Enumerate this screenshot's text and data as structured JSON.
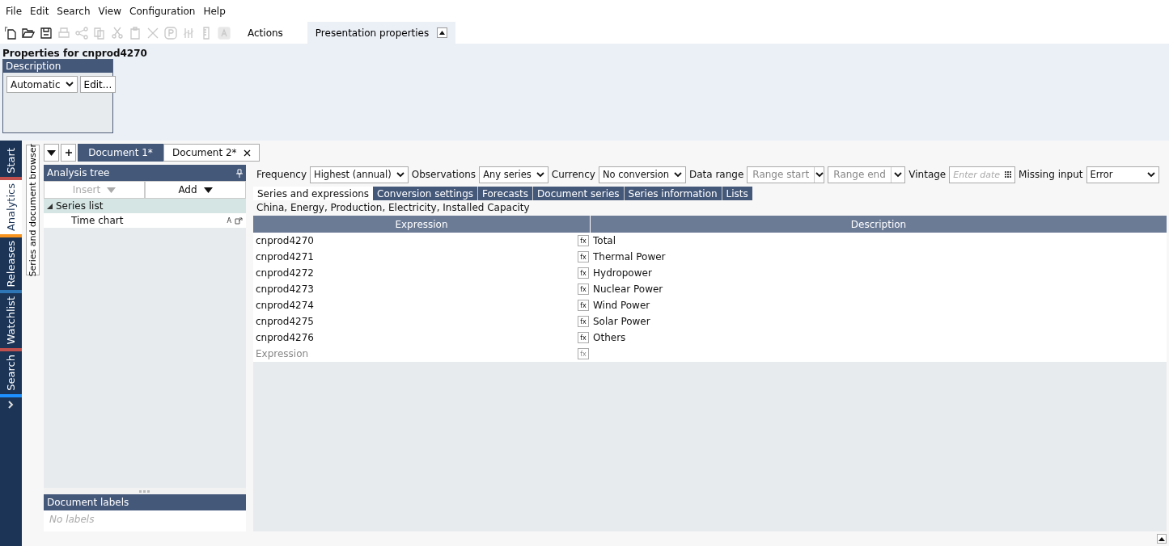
{
  "menu": [
    "File",
    "Edit",
    "Search",
    "View",
    "Configuration",
    "Help"
  ],
  "toolbar": {
    "tools": [
      {
        "kind": "new",
        "disabled": false
      },
      {
        "kind": "open",
        "disabled": false
      },
      {
        "kind": "save",
        "disabled": false
      },
      {
        "kind": "print",
        "disabled": true
      },
      {
        "kind": "share",
        "disabled": true
      },
      {
        "kind": "copy",
        "disabled": true
      },
      {
        "kind": "cut",
        "disabled": true
      },
      {
        "kind": "paste",
        "disabled": true
      },
      {
        "kind": "delete",
        "disabled": true
      },
      {
        "kind": "p",
        "disabled": true
      },
      {
        "kind": "chart",
        "disabled": true
      },
      {
        "kind": "ruler",
        "disabled": true
      },
      {
        "kind": "a",
        "disabled": true
      }
    ],
    "tabs": [
      {
        "label": "Actions",
        "selected": false
      },
      {
        "label": "Presentation properties",
        "selected": true
      }
    ]
  },
  "properties": {
    "title": "Properties for cnprod4270",
    "group": "Description",
    "select": "Automatic",
    "button": "Edit..."
  },
  "side_tabs": [
    {
      "label": "Start",
      "selected": false,
      "color": "#c0504d"
    },
    {
      "label": "Analytics",
      "selected": true,
      "color": "#f7931e"
    },
    {
      "label": "Releases",
      "selected": false,
      "color": "#2e75b6"
    },
    {
      "label": "Watchlist",
      "selected": false,
      "color": "#c0504d"
    },
    {
      "label": "Search",
      "selected": false,
      "color": "#1e90ff"
    }
  ],
  "browser_tab": "Series and document browser",
  "doc_tabs": [
    {
      "label": "Document 1*",
      "selected": false
    },
    {
      "label": "Document 2*",
      "selected": true
    }
  ],
  "analysis_tree": {
    "title": "Analysis tree",
    "insert": "Insert",
    "add": "Add",
    "items": [
      {
        "label": "Series list",
        "selected": true,
        "expanded": true,
        "children": [
          {
            "label": "Time chart",
            "selected": false,
            "badge": "A"
          }
        ]
      }
    ]
  },
  "labels": {
    "title": "Document labels",
    "placeholder": "No labels"
  },
  "settings": [
    {
      "label": "Frequency",
      "value": "Highest (annual)"
    },
    {
      "label": "Observations",
      "value": "Any series"
    },
    {
      "label": "Currency",
      "value": "No conversion"
    }
  ],
  "data_range": {
    "label": "Data range",
    "start": "Range start",
    "end": "Range end"
  },
  "vintage": {
    "label": "Vintage",
    "placeholder": "Enter date"
  },
  "missing": {
    "label": "Missing input",
    "value": "Error"
  },
  "view_tabs": [
    {
      "label": "Series and expressions",
      "selected": true
    },
    {
      "label": "Conversion settings",
      "selected": false
    },
    {
      "label": "Forecasts",
      "selected": false
    },
    {
      "label": "Document series",
      "selected": false
    },
    {
      "label": "Series information",
      "selected": false
    },
    {
      "label": "Lists",
      "selected": false
    }
  ],
  "breadcrumb": "China, Energy, Production, Electricity, Installed Capacity",
  "table": {
    "columns": [
      "Expression",
      "Description"
    ],
    "rows": [
      {
        "expression": "cnprod4270",
        "fx": "fx",
        "description": "Total"
      },
      {
        "expression": "cnprod4271",
        "fx": "fx",
        "description": "Thermal Power"
      },
      {
        "expression": "cnprod4272",
        "fx": "fx",
        "description": "Hydropower"
      },
      {
        "expression": "cnprod4273",
        "fx": "fx",
        "description": "Nuclear Power"
      },
      {
        "expression": "cnprod4274",
        "fx": "fx",
        "description": "Wind Power"
      },
      {
        "expression": "cnprod4275",
        "fx": "fx",
        "description": "Solar Power"
      },
      {
        "expression": "cnprod4276",
        "fx": "fx",
        "description": "Others"
      }
    ],
    "placeholder": "Expression",
    "placeholder_fx": "fx"
  }
}
